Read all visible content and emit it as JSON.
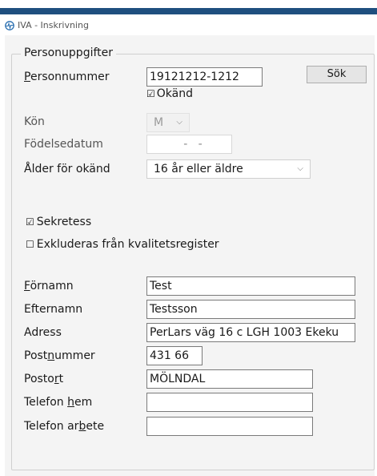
{
  "window": {
    "title": "IVA - Inskrivning"
  },
  "group": {
    "title": "Personuppgifter"
  },
  "personnummer": {
    "label_initial": "P",
    "label_rest": "ersonnummer",
    "value": "19121212-1212",
    "search_button": "Sök",
    "okand_checked": "☑",
    "okand_label": "Okänd"
  },
  "kon": {
    "label": "Kön",
    "value": "M"
  },
  "fodelsedatum": {
    "label": "Födelsedatum",
    "value": "  -   -"
  },
  "alder": {
    "label": "Ålder för okänd",
    "value": "16 år eller äldre"
  },
  "checkboxes": [
    {
      "mark": "☑",
      "label": "Sekretess"
    },
    {
      "mark": "☐",
      "label": "Exkluderas från kvalitetsregister"
    }
  ],
  "fornamn": {
    "label_initial": "F",
    "label_rest": "örnamn",
    "value": "Test"
  },
  "efternamn": {
    "label": "Efternamn",
    "value": "Testsson"
  },
  "adress": {
    "label": "Adress",
    "value": "PerLars väg 16 c LGH 1003 Ekeku"
  },
  "postnummer": {
    "label_pre": "Post",
    "label_mn": "n",
    "label_post": "ummer",
    "value": "431 66"
  },
  "postort": {
    "label_pre": "Posto",
    "label_mn": "r",
    "label_post": "t",
    "value": "MÖLNDAL"
  },
  "telefon_hem": {
    "label_pre": "Telefon ",
    "label_mn": "h",
    "label_post": "em",
    "value": ""
  },
  "telefon_arbete": {
    "label_pre": "Telefon ar",
    "label_mn": "b",
    "label_post": "ete",
    "value": ""
  },
  "colors": {
    "accent_bar": "#1f4f7f",
    "panel_bg": "#f4f4f4"
  },
  "icons": {
    "app": "app-logo-icon",
    "dropdown": "chevron-down-icon"
  }
}
